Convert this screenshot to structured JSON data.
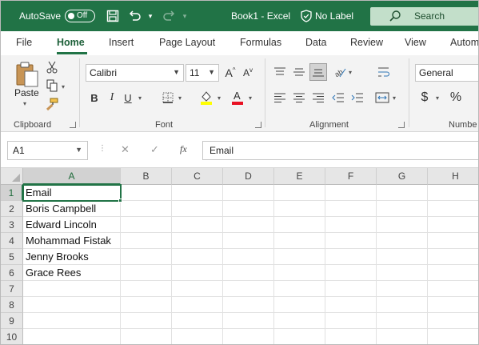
{
  "titlebar": {
    "autosave_label": "AutoSave",
    "autosave_state": "Off",
    "document_title": "Book1 - Excel",
    "sensitivity_label": "No Label",
    "search_label": "Search",
    "save_icon": "save-icon",
    "undo_icon": "undo-icon",
    "redo_icon": "redo-icon",
    "accent_color": "#217346"
  },
  "ribbon_tabs": [
    "File",
    "Home",
    "Insert",
    "Page Layout",
    "Formulas",
    "Data",
    "Review",
    "View",
    "Autom"
  ],
  "active_tab": "Home",
  "ribbon": {
    "clipboard": {
      "paste_label": "Paste",
      "group_label": "Clipboard"
    },
    "font": {
      "font_name": "Calibri",
      "font_size": "11",
      "bold": "B",
      "italic": "I",
      "underline": "U",
      "grow": "A",
      "shrink": "A",
      "group_label": "Font",
      "highlight_color": "#ffff00",
      "font_color": "#e81123"
    },
    "alignment": {
      "group_label": "Alignment"
    },
    "number": {
      "format": "General",
      "group_label": "Numbe",
      "currency": "$",
      "percent": "%"
    }
  },
  "formula_bar": {
    "name_box": "A1",
    "fx_label": "fx",
    "cancel_symbol": "✕",
    "enter_symbol": "✓",
    "formula_value": "Email"
  },
  "grid": {
    "columns": [
      "A",
      "B",
      "C",
      "D",
      "E",
      "F",
      "G",
      "H"
    ],
    "rows": [
      "1",
      "2",
      "3",
      "4",
      "5",
      "6",
      "7",
      "8",
      "9",
      "10"
    ],
    "selected_column": "A",
    "selected_row": "1",
    "cells_col_a": [
      "Email",
      "Boris Campbell",
      "Edward Lincoln",
      "Mohammad Fistak",
      "Jenny Brooks",
      "Grace Rees",
      "",
      "",
      "",
      ""
    ]
  }
}
